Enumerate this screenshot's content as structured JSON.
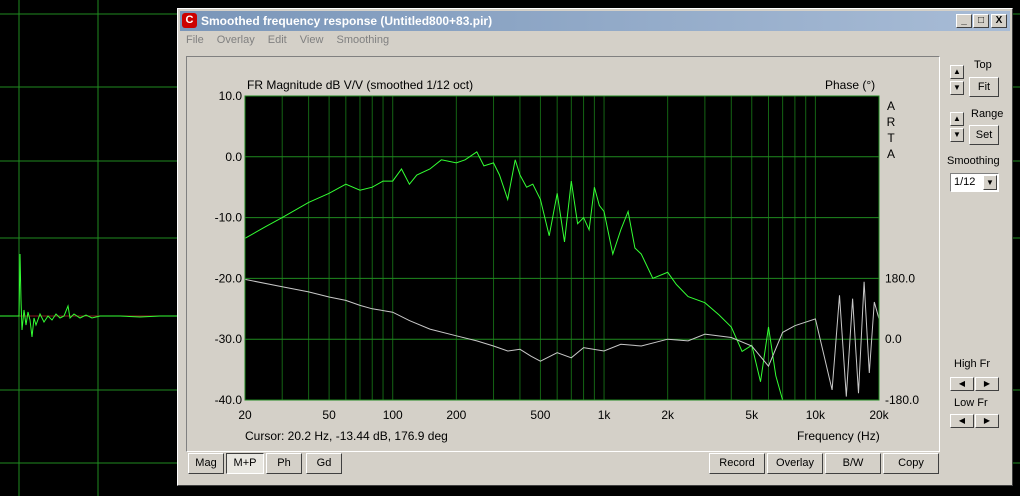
{
  "window": {
    "title": "Smoothed frequency response (Untitled800+83.pir)",
    "controls": [
      "_",
      "□",
      "X"
    ]
  },
  "menu": [
    "File",
    "Overlay",
    "Edit",
    "View",
    "Smoothing"
  ],
  "plot": {
    "title": "FR Magnitude dB V/V (smoothed 1/12 oct)",
    "phase_label": "Phase (°)",
    "brand": [
      "A",
      "R",
      "T",
      "A"
    ],
    "cursor": "Cursor: 20.2 Hz, -13.44 dB, 176.9 deg",
    "xlabel": "Frequency (Hz)"
  },
  "chart_data": {
    "type": "line",
    "title": "FR Magnitude dB V/V (smoothed 1/12 oct)",
    "xlabel": "Frequency (Hz)",
    "ylabel": "",
    "xscale": "log",
    "xlim": [
      20,
      20000
    ],
    "ylim": [
      -40,
      10
    ],
    "y2lim": [
      -180,
      180
    ],
    "grid": true,
    "x_ticks": [
      "20",
      "50",
      "100",
      "200",
      "500",
      "1k",
      "2k",
      "5k",
      "10k",
      "20k"
    ],
    "x_tick_values": [
      20,
      50,
      100,
      200,
      500,
      1000,
      2000,
      5000,
      10000,
      20000
    ],
    "y_ticks": [
      "10.0",
      "0.0",
      "-10.0",
      "-20.0",
      "-30.0",
      "-40.0"
    ],
    "y_tick_values": [
      10,
      0,
      -10,
      -20,
      -30,
      -40
    ],
    "y2_ticks": [
      "180.0",
      "0.0",
      "-180.0"
    ],
    "y2_tick_values": [
      180,
      0,
      -180
    ],
    "series": [
      {
        "color": "#33ff33",
        "x": [
          20,
          25,
          30,
          40,
          50,
          60,
          70,
          80,
          90,
          100,
          110,
          120,
          130,
          150,
          170,
          200,
          220,
          250,
          270,
          300,
          320,
          350,
          380,
          400,
          430,
          460,
          500,
          550,
          600,
          650,
          700,
          750,
          800,
          850,
          900,
          950,
          1000,
          1100,
          1200,
          1300,
          1400,
          1500,
          1700,
          2000,
          2200,
          2500,
          3000,
          3500,
          4000,
          4500,
          5000,
          5500,
          6000,
          6500,
          7000
        ],
        "values": [
          -13.4,
          -11.5,
          -10,
          -7.5,
          -6,
          -4.5,
          -5.5,
          -5,
          -4,
          -4,
          -2,
          -4.5,
          -3,
          -2,
          -0.5,
          -1,
          -0.5,
          0.8,
          -1.5,
          -1,
          -3,
          -7,
          -0.5,
          -3,
          -5,
          -4.5,
          -7,
          -13,
          -6,
          -14,
          -4,
          -11,
          -10,
          -12,
          -5,
          -8,
          -9,
          -16,
          -12,
          -9,
          -15,
          -16,
          -20,
          -19,
          -21,
          -23,
          -24,
          -26,
          -28,
          -32,
          -31,
          -37,
          -28,
          -36,
          -40
        ]
      },
      {
        "color": "#c8c8c8",
        "axis": "phase",
        "x": [
          20,
          30,
          40,
          50,
          60,
          70,
          80,
          100,
          120,
          150,
          200,
          250,
          300,
          350,
          400,
          450,
          500,
          600,
          700,
          800,
          1000,
          1200,
          1500,
          2000,
          2500,
          3000,
          4000,
          5000,
          6000,
          7000,
          8000,
          10000,
          12000,
          13000,
          14000,
          15000,
          16000,
          17000,
          18000,
          19000,
          20000
        ],
        "values": [
          176.9,
          155,
          140,
          125,
          115,
          100,
          90,
          80,
          55,
          30,
          10,
          -5,
          -20,
          -35,
          -30,
          -50,
          -65,
          -40,
          -55,
          -25,
          -35,
          -15,
          -20,
          0,
          -5,
          15,
          5,
          -20,
          -80,
          20,
          40,
          60,
          -150,
          130,
          -170,
          120,
          -160,
          170,
          -100,
          110,
          60
        ]
      }
    ]
  },
  "right_panel": {
    "top_label": "Top",
    "fit_label": "Fit",
    "range_label": "Range",
    "set_label": "Set",
    "smoothing_label": "Smoothing",
    "smoothing_value": "1/12",
    "highfr_label": "High Fr",
    "lowfr_label": "Low Fr"
  },
  "bottom_left_buttons": [
    "Mag",
    "M+P",
    "Ph",
    "Gd"
  ],
  "bottom_right_buttons": [
    "Record",
    "Overlay",
    "B/W",
    "Copy"
  ]
}
